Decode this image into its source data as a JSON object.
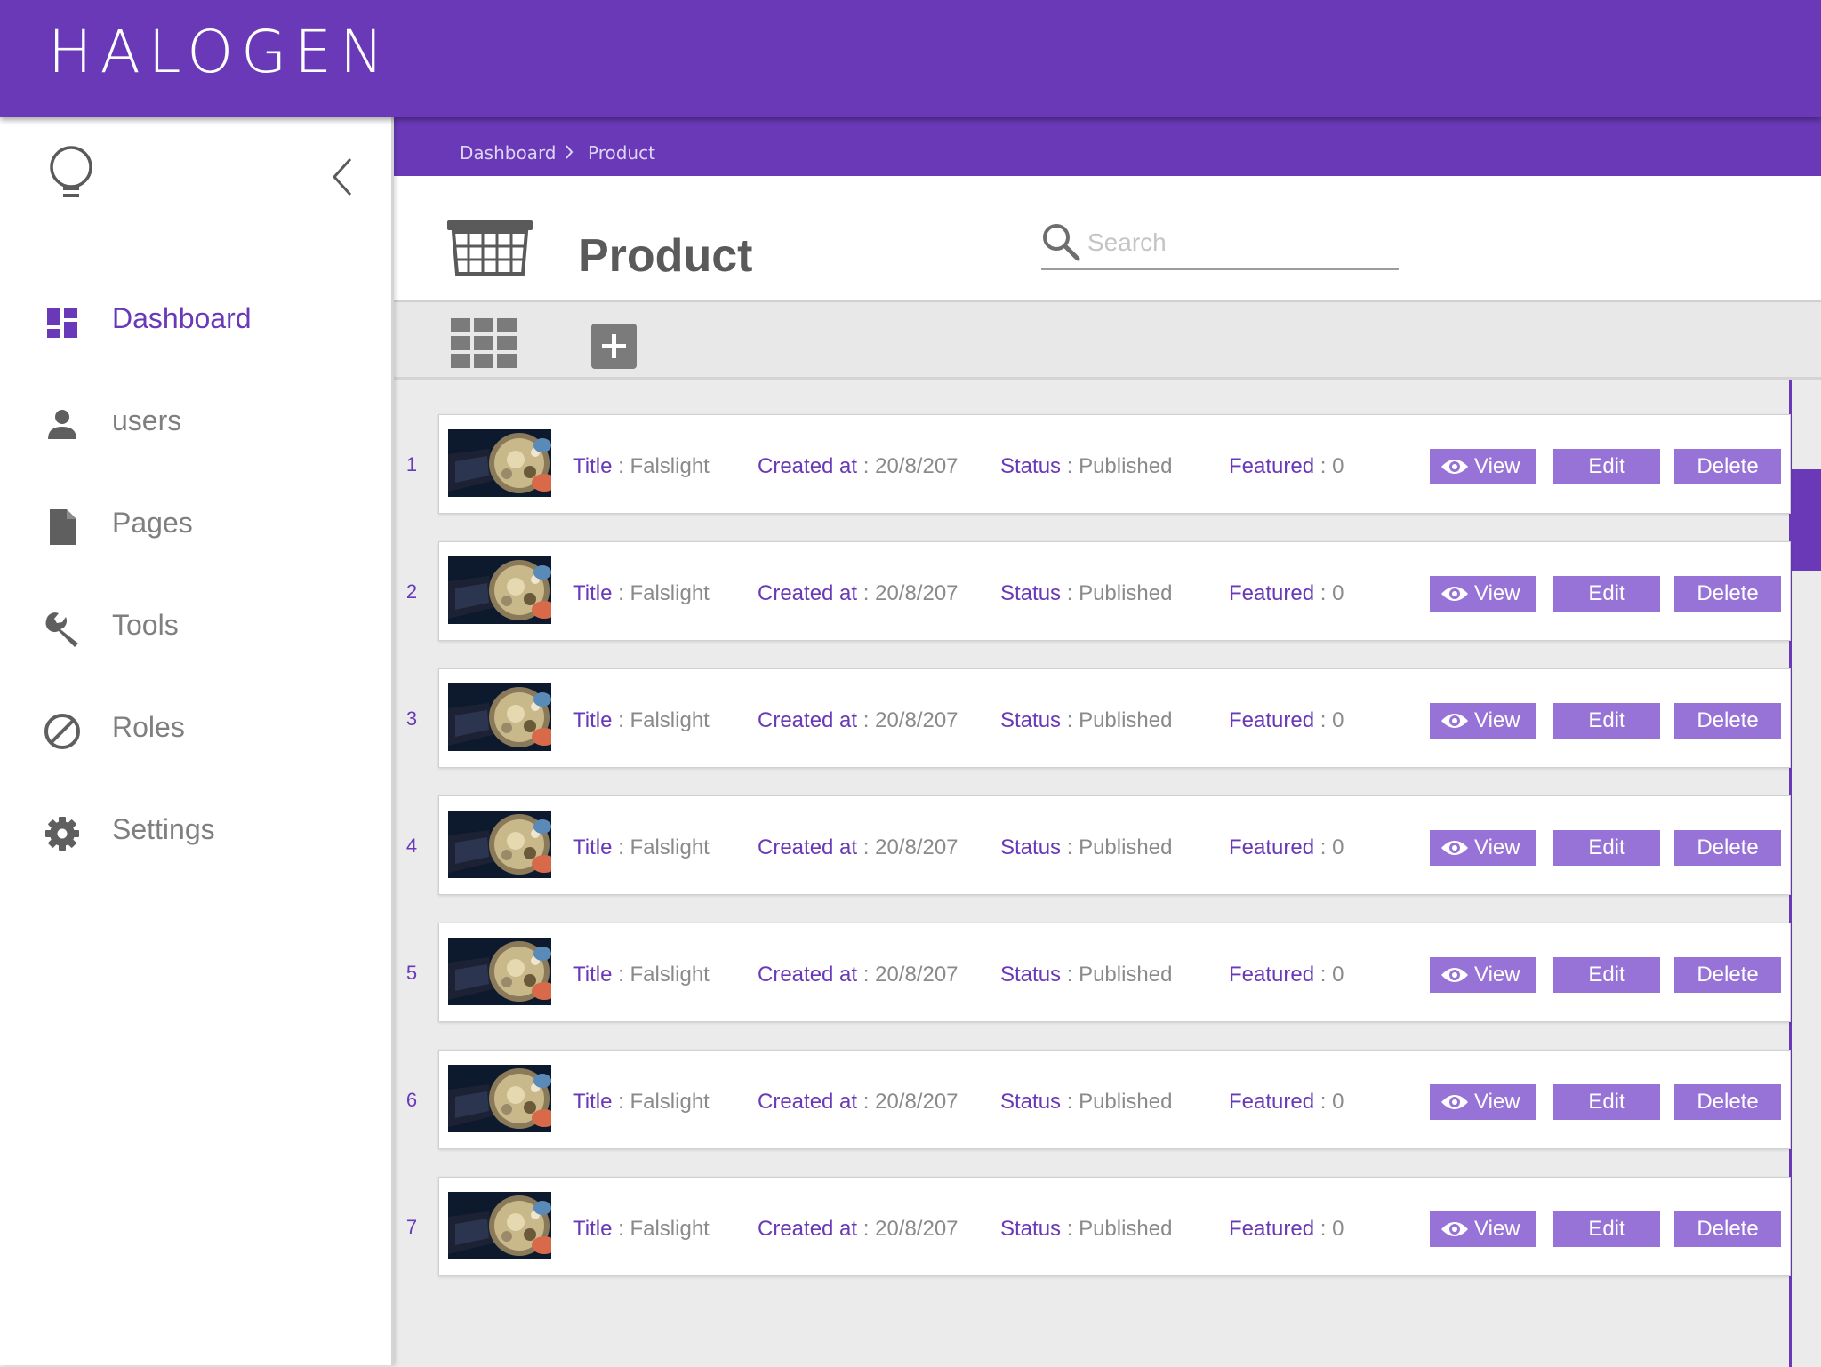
{
  "app": {
    "logo": "HALOGEN",
    "accent": "#6939b8",
    "button_color": "#9773d8"
  },
  "sidebar": {
    "items": [
      {
        "label": "Dashboard",
        "icon": "dashboard-icon",
        "active": true
      },
      {
        "label": "users",
        "icon": "user-icon",
        "active": false
      },
      {
        "label": "Pages",
        "icon": "page-icon",
        "active": false
      },
      {
        "label": "Tools",
        "icon": "wrench-icon",
        "active": false
      },
      {
        "label": "Roles",
        "icon": "block-icon",
        "active": false
      },
      {
        "label": "Settings",
        "icon": "gear-icon",
        "active": false
      }
    ]
  },
  "breadcrumb": {
    "items": [
      "Dashboard",
      "Product"
    ]
  },
  "header": {
    "title": "Product",
    "icon": "basket-icon"
  },
  "search": {
    "placeholder": "Search",
    "value": ""
  },
  "toolbar": {
    "grid_icon": "grid-view-icon",
    "add_icon": "add-icon"
  },
  "list": {
    "labels": {
      "title": "Title",
      "created": "Created at",
      "status": "Status",
      "featured": "Featured",
      "separator": " : "
    },
    "actions": {
      "view": "View",
      "edit": "Edit",
      "delete": "Delete"
    },
    "rows": [
      {
        "num": "1",
        "title": "Falslight",
        "created": "20/8/207",
        "status": "Published",
        "featured": "0"
      },
      {
        "num": "2",
        "title": "Falslight",
        "created": "20/8/207",
        "status": "Published",
        "featured": "0"
      },
      {
        "num": "3",
        "title": "Falslight",
        "created": "20/8/207",
        "status": "Published",
        "featured": "0"
      },
      {
        "num": "4",
        "title": "Falslight",
        "created": "20/8/207",
        "status": "Published",
        "featured": "0"
      },
      {
        "num": "5",
        "title": "Falslight",
        "created": "20/8/207",
        "status": "Published",
        "featured": "0"
      },
      {
        "num": "6",
        "title": "Falslight",
        "created": "20/8/207",
        "status": "Published",
        "featured": "0"
      },
      {
        "num": "7",
        "title": "Falslight",
        "created": "20/8/207",
        "status": "Published",
        "featured": "0"
      }
    ]
  }
}
